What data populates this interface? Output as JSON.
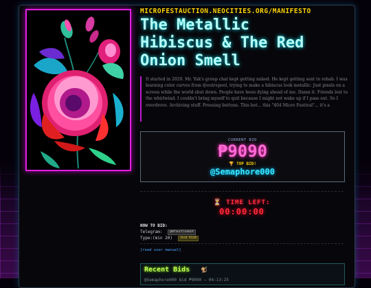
{
  "url": "MICROFESTAUCTION.NEOCITIES.ORG/MANIFESTO",
  "title_lines": [
    "The Metallic",
    "Hibiscus & The Red",
    "Onion Smell"
  ],
  "story": "It started in 2020. Mr. Yuk's group chat kept getting nuked. He kept getting sent to rehab. I was learning color curves from @outrepool, trying to make a hibiscus look metallic. Just pixels on a screen while the world shut down. People have been dying ahead of me. Damn it. Friends lost to the whirlwind. I couldn't bring myself to quit because I might not wake up if I pass out. So I overdrove. Archiving stuff. Pressing buttons. This bot... this \"404 Micro Festival\"... it's a",
  "bid": {
    "current_label": "CURRENT BID",
    "amount": "₱9090",
    "top_label": "🏆 TOP BID!",
    "top_bidder": "@Semaphore000"
  },
  "timer": {
    "label": "⏳ TIME LEFT:",
    "value": "00:00:00"
  },
  "howto": {
    "heading": "HOW TO BID:",
    "telegram_label": "Telegram:",
    "telegram_handle": "@mfauctionbot",
    "type_label": "Type:(min 20)",
    "type_command": "/bid 9110"
  },
  "manual_link": "[read user manual]",
  "recent": {
    "title": "Recent Bids",
    "icon": "🐒",
    "row": "@Semaphore000 bid ₱9090 — 04:13:25"
  },
  "colors": {
    "accent_pink": "#ff2fbf",
    "accent_cyan": "#00e5ff",
    "url_yellow": "#ffd400",
    "timer_red": "#ff2a3a",
    "recent_green": "#c6ff5a"
  }
}
